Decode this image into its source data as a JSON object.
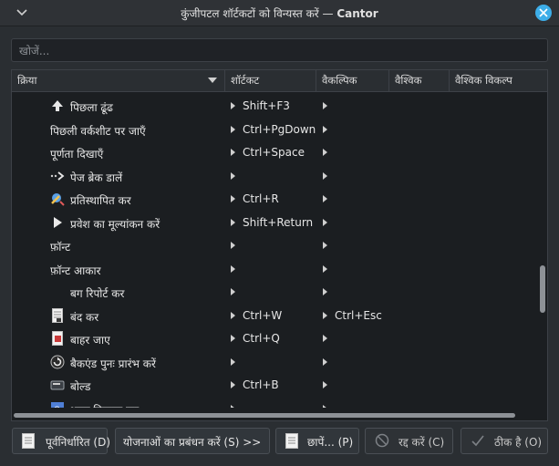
{
  "window": {
    "title_prefix": "कुंजीपटल शॉर्टकटों को विन्यस्त करें",
    "title_sep": " — ",
    "title_app": "Cantor"
  },
  "search": {
    "placeholder": "खोजें...",
    "value": ""
  },
  "columns": [
    "क्रिया",
    "शॉर्टकट",
    "वैकल्पिक",
    "वैश्विक",
    "वैश्विक विकल्प"
  ],
  "rows": [
    {
      "label": "पिछला ढूंढ",
      "icon": "find-previous-icon",
      "shortcut": "Shift+F3",
      "alternate": ""
    },
    {
      "label": "पिछली वर्कशीट पर जाएँ",
      "icon": "",
      "shortcut": "Ctrl+PgDown",
      "alternate": ""
    },
    {
      "label": "पूर्णता दिखाएँ",
      "icon": "",
      "shortcut": "Ctrl+Space",
      "alternate": ""
    },
    {
      "label": "पेज ब्रेक डालें",
      "icon": "page-break-icon",
      "shortcut": "",
      "alternate": ""
    },
    {
      "label": "प्रतिस्थापित कर",
      "icon": "replace-icon",
      "shortcut": "Ctrl+R",
      "alternate": ""
    },
    {
      "label": "प्रवेश का मूल्यांकन करें",
      "icon": "play-icon",
      "shortcut": "Shift+Return",
      "alternate": ""
    },
    {
      "label": "फ़ॉन्ट",
      "icon": "",
      "shortcut": "",
      "alternate": ""
    },
    {
      "label": "फ़ॉन्ट आकार",
      "icon": "",
      "shortcut": "",
      "alternate": ""
    },
    {
      "label": "बग रिपोर्ट कर",
      "icon": "bug-icon",
      "shortcut": "",
      "alternate": ""
    },
    {
      "label": "बंद कर",
      "icon": "close-document-icon",
      "shortcut": "Ctrl+W",
      "alternate": "Ctrl+Esc"
    },
    {
      "label": "बाहर जाए",
      "icon": "exit-icon",
      "shortcut": "Ctrl+Q",
      "alternate": ""
    },
    {
      "label": "बैकएंड पुनः प्रारंभ करें",
      "icon": "restart-icon",
      "shortcut": "",
      "alternate": ""
    },
    {
      "label": "बोल्ड",
      "icon": "bold-icon",
      "shortcut": "Ctrl+B",
      "alternate": ""
    },
    {
      "label": "भाषा विन्यस्त कर",
      "icon": "configure-language-icon",
      "shortcut": "",
      "alternate": ""
    }
  ],
  "buttons": {
    "defaults": "पूर्वनिर्धारित (D)",
    "manage_schemes": "योजनाओं का प्रबंधन करें (S) >>",
    "print": "छापें... (P)",
    "cancel": "रद्द करें (C)",
    "ok": "ठीक है (O)"
  },
  "colors": {
    "accent": "#3daee9",
    "background": "#2a2e32",
    "list_bg": "#1b1e21"
  }
}
